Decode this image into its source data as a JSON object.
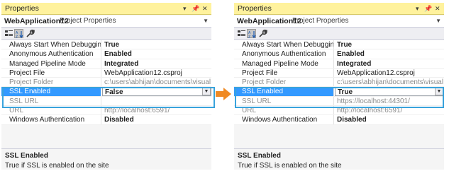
{
  "left": {
    "title": "Properties",
    "title_buttons": [
      "▾",
      "📌",
      "✕"
    ],
    "object": {
      "name": "WebApplication12",
      "type": "Project Properties"
    },
    "rows": [
      {
        "key": "Always Start When Debugging",
        "value": "True",
        "bold": true,
        "grey": false
      },
      {
        "key": "Anonymous Authentication",
        "value": "Enabled",
        "bold": true,
        "grey": false
      },
      {
        "key": "Managed Pipeline Mode",
        "value": "Integrated",
        "bold": true,
        "grey": false
      },
      {
        "key": "Project File",
        "value": "WebApplication12.csproj",
        "bold": false,
        "grey": false
      },
      {
        "key": "Project Folder",
        "value": "c:\\users\\abhijan\\documents\\visual stud",
        "bold": false,
        "grey": true
      },
      {
        "key": "SSL Enabled",
        "value": "False",
        "bold": true,
        "grey": false,
        "selected": true
      },
      {
        "key": "SSL URL",
        "value": "",
        "bold": false,
        "grey": true
      },
      {
        "key": "URL",
        "value": "http://localhost:6591/",
        "bold": false,
        "grey": true
      },
      {
        "key": "Windows Authentication",
        "value": "Disabled",
        "bold": true,
        "grey": false
      }
    ],
    "desc_title": "SSL Enabled",
    "desc_text": "True if SSL is enabled on the site"
  },
  "right": {
    "title": "Properties",
    "title_buttons": [
      "▾",
      "📌",
      "✕"
    ],
    "object": {
      "name": "WebApplication12",
      "type": "Project Properties"
    },
    "rows": [
      {
        "key": "Always Start When Debugging",
        "value": "True",
        "bold": true,
        "grey": false
      },
      {
        "key": "Anonymous Authentication",
        "value": "Enabled",
        "bold": true,
        "grey": false
      },
      {
        "key": "Managed Pipeline Mode",
        "value": "Integrated",
        "bold": true,
        "grey": false
      },
      {
        "key": "Project File",
        "value": "WebApplication12.csproj",
        "bold": false,
        "grey": false
      },
      {
        "key": "Project Folder",
        "value": "c:\\users\\abhijan\\documents\\visual studi",
        "bold": false,
        "grey": true
      },
      {
        "key": "SSL Enabled",
        "value": "True",
        "bold": true,
        "grey": false,
        "selected": true
      },
      {
        "key": "SSL URL",
        "value": "https://localhost:44301/",
        "bold": false,
        "grey": true
      },
      {
        "key": "URL",
        "value": "http://localhost:6591/",
        "bold": false,
        "grey": true
      },
      {
        "key": "Windows Authentication",
        "value": "Disabled",
        "bold": true,
        "grey": false
      }
    ],
    "desc_title": "SSL Enabled",
    "desc_text": "True if SSL is enabled on the site"
  },
  "colors": {
    "titlebar": "#fff29d",
    "selection": "#3399ff",
    "highlight_box": "#39a3dc",
    "arrow": "#f08a24"
  },
  "icons": {
    "categorized": "categorized-icon",
    "alphabetical": "alphabetical-sort-icon",
    "property_pages": "wrench-icon"
  }
}
